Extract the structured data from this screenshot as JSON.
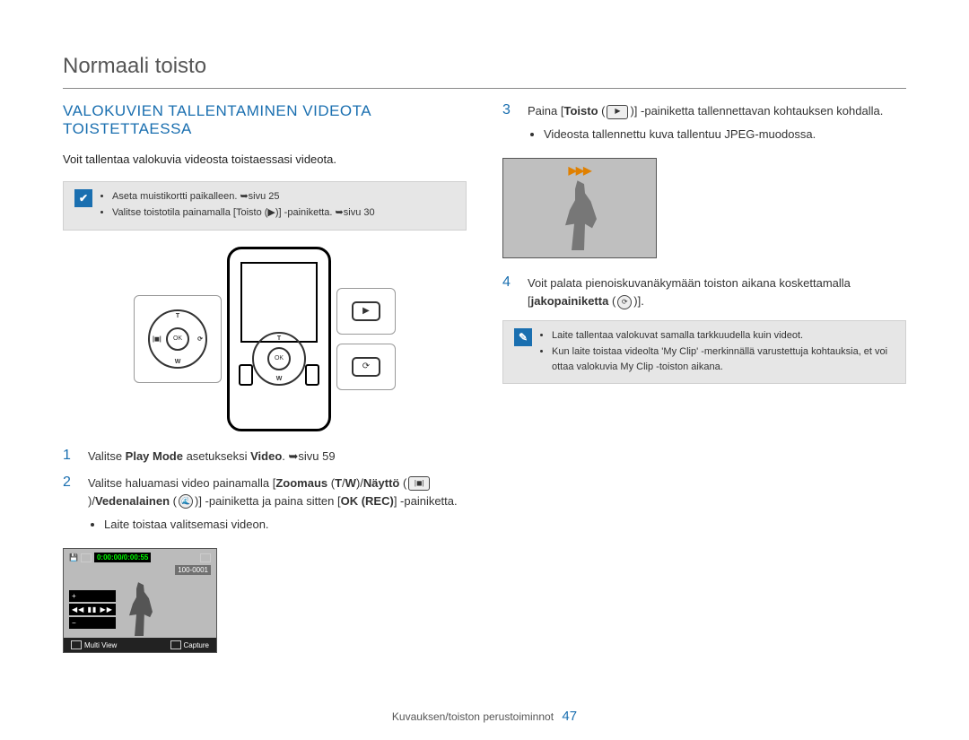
{
  "page_title": "Normaali toisto",
  "section_heading": "VALOKUVIEN TALLENTAMINEN VIDEOTA TOISTETTAESSA",
  "intro": "Voit tallentaa valokuvia videosta toistaessasi videota.",
  "note1": {
    "items": [
      "Aseta muistikortti paikalleen. ➥sivu 25",
      "Valitse toistotila painamalla [Toisto (▶)] -painiketta. ➥sivu 30"
    ]
  },
  "device": {
    "dpad_center": "OK",
    "dpad_t": "T",
    "dpad_w": "W",
    "dpad_l": "|◼|",
    "dpad_r": "⟳",
    "right_btn_play": "▶",
    "right_btn_share": "⟳"
  },
  "steps_left": [
    {
      "num": "1",
      "body": "Valitse Play Mode asetukseksi Video. ➥sivu 59",
      "strong": [
        "Play Mode",
        "Video"
      ]
    },
    {
      "num": "2",
      "body_pre": "Valitse haluamasi video painamalla [",
      "body_controls": "Zoomaus (T/W)/Näyttö (|◼|)/Vedenalainen (🌊)",
      "body_post": "] -painiketta ja paina sitten [OK (REC)] -painiketta.",
      "bullets": [
        "Laite toistaa valitsemasi videon."
      ]
    }
  ],
  "thumb": {
    "timer": "0:00:00/0:00:55",
    "id": "100-0001",
    "ctrl_plus": "+",
    "ctrl_play": "◀◀ ▮▮ ▶▶",
    "ctrl_minus": "−",
    "bottom_left": "Multi View",
    "bottom_right": "Capture"
  },
  "steps_right": [
    {
      "num": "3",
      "body_pre": "Paina [",
      "body_bold": "Toisto",
      "body_icon": "▶",
      "body_post": "] -painiketta tallennettavan kohtauksen kohdalla.",
      "bullets": [
        "Videosta tallennettu kuva tallentuu JPEG-muodossa."
      ]
    },
    {
      "num": "4",
      "body_pre": "Voit palata pienoiskuvanäkymään toiston aikana koskettamalla [",
      "body_bold": "jakopainiketta",
      "body_icon": "⟳",
      "body_post": "]."
    }
  ],
  "note2": {
    "items": [
      "Laite tallentaa valokuvat samalla tarkkuudella kuin videot.",
      "Kun laite toistaa videolta 'My Clip' -merkinnällä varustettuja kohtauksia, et voi ottaa valokuvia My Clip -toiston aikana."
    ]
  },
  "screenshot": {
    "fwd": "▶▶▶"
  },
  "footer": {
    "chapter": "Kuvauksen/toiston perustoiminnot",
    "page": "47"
  }
}
